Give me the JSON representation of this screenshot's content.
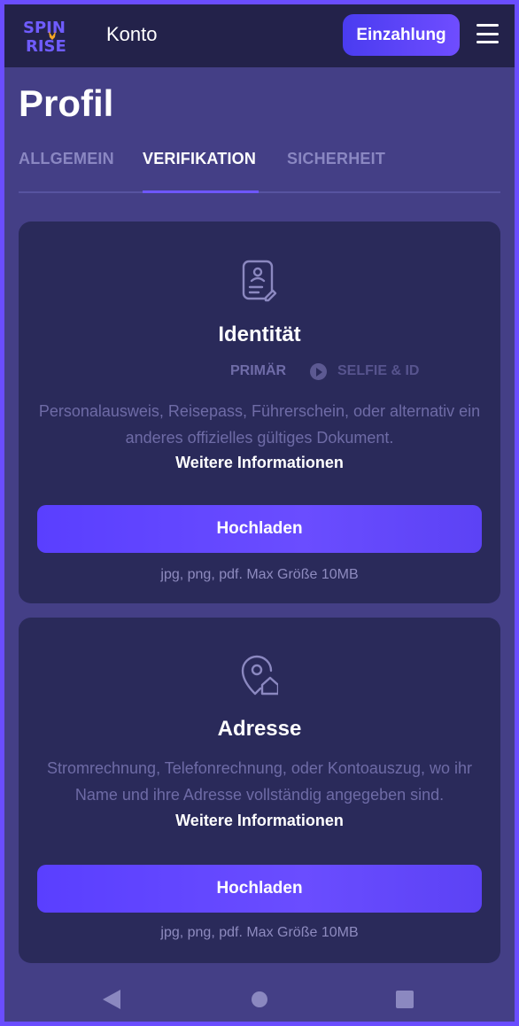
{
  "header": {
    "logo_top": "SPIN",
    "logo_bottom": "RISE",
    "title": "Konto",
    "deposit_label": "Einzahlung"
  },
  "page": {
    "title": "Profil",
    "tabs": [
      {
        "label": "ALLGEMEIN",
        "active": false
      },
      {
        "label": "VERIFIKATION",
        "active": true
      },
      {
        "label": "SICHERHEIT",
        "active": false
      }
    ]
  },
  "cards": [
    {
      "icon": "id-document-icon",
      "title": "Identität",
      "steps": [
        "PRIMÄR",
        "SELFIE & ID"
      ],
      "description": "Personalausweis, Reisepass, Führerschein, oder alternativ ein anderes offizielles gültiges Dokument.",
      "more_link": "Weitere Informationen",
      "upload_label": "Hochladen",
      "file_hint": "jpg, png, pdf. Max Größe 10MB"
    },
    {
      "icon": "location-home-icon",
      "title": "Adresse",
      "description": "Stromrechnung, Telefonrechnung, oder Kontoauszug, wo ihr Name und ihre Adresse vollständig angegeben sind.",
      "more_link": "Weitere Informationen",
      "upload_label": "Hochladen",
      "file_hint": "jpg, png, pdf. Max Größe 10MB"
    }
  ],
  "colors": {
    "accent": "#6a4dff",
    "background": "#443f86",
    "header": "#23224a",
    "card": "#2a2a5a"
  },
  "system_nav": [
    "back-icon",
    "home-icon",
    "recent-apps-icon"
  ]
}
